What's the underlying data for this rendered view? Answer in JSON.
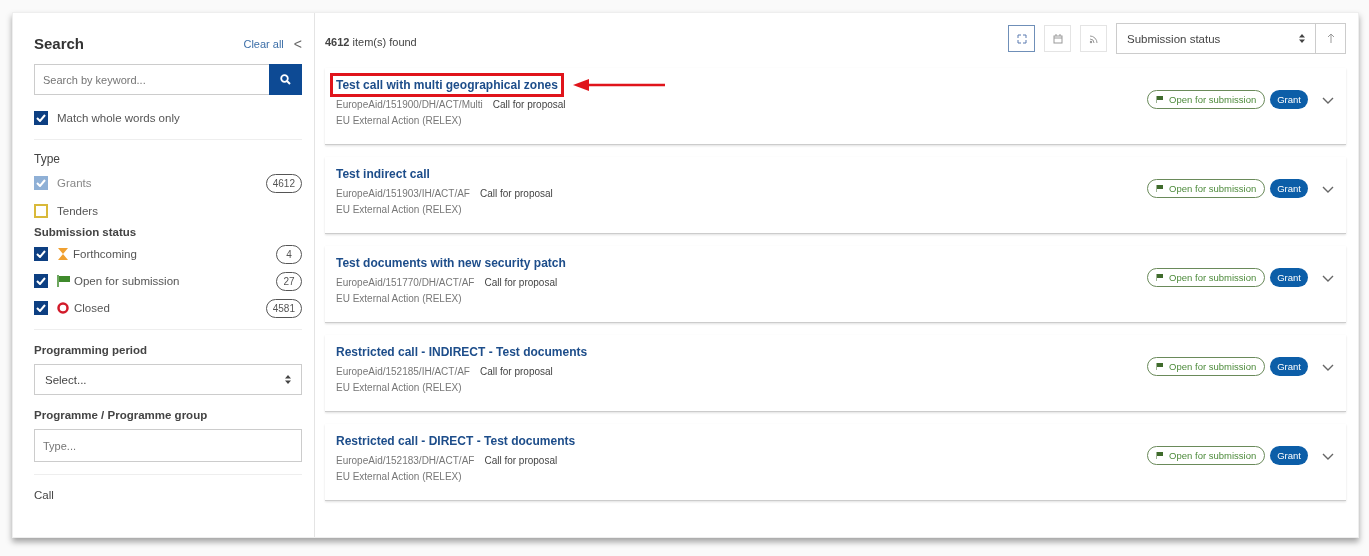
{
  "sidebar": {
    "title": "Search",
    "clear_all": "Clear all",
    "collapse": "<",
    "search": {
      "placeholder": "Search by keyword..."
    },
    "match_whole_words": {
      "label": "Match whole words only",
      "checked": true
    },
    "type": {
      "title": "Type",
      "items": [
        {
          "label": "Grants",
          "count": "4612",
          "checked": true,
          "disabled": true
        },
        {
          "label": "Tenders",
          "checked": false,
          "disabled": false
        }
      ]
    },
    "submission_status": {
      "title": "Submission status",
      "items": [
        {
          "kind": "forthcoming",
          "label": "Forthcoming",
          "count": "4",
          "checked": true
        },
        {
          "kind": "open",
          "label": "Open for submission",
          "count": "27",
          "checked": true
        },
        {
          "kind": "closed",
          "label": "Closed",
          "count": "4581",
          "checked": true
        }
      ]
    },
    "programming_period": {
      "label": "Programming period",
      "value": "Select..."
    },
    "programme": {
      "label": "Programme / Programme group",
      "placeholder": "Type..."
    },
    "call": {
      "label": "Call"
    }
  },
  "results": {
    "count": "4612",
    "count_label": "item(s) found",
    "views": [
      {
        "kind": "grid",
        "selected": true
      },
      {
        "kind": "calendar",
        "selected": false
      },
      {
        "kind": "rss",
        "selected": false
      }
    ],
    "sort": {
      "value": "Submission status"
    },
    "items": [
      {
        "title": "Test call with multi geographical zones",
        "reference": "EuropeAid/151900/DH/ACT/Multi",
        "type": "Call for proposal",
        "programme": "EU External Action (RELEX)",
        "status": "Open for submission",
        "badge": "Grant",
        "highlighted": true
      },
      {
        "title": "Test indirect call",
        "reference": "EuropeAid/151903/IH/ACT/AF",
        "type": "Call for proposal",
        "programme": "EU External Action (RELEX)",
        "status": "Open for submission",
        "badge": "Grant",
        "highlighted": false
      },
      {
        "title": "Test documents with new security patch",
        "reference": "EuropeAid/151770/DH/ACT/AF",
        "type": "Call for proposal",
        "programme": "EU External Action (RELEX)",
        "status": "Open for submission",
        "badge": "Grant",
        "highlighted": false
      },
      {
        "title": "Restricted call - INDIRECT - Test documents",
        "reference": "EuropeAid/152185/IH/ACT/AF",
        "type": "Call for proposal",
        "programme": "EU External Action (RELEX)",
        "status": "Open for submission",
        "badge": "Grant",
        "highlighted": false
      },
      {
        "title": "Restricted call - DIRECT - Test documents",
        "reference": "EuropeAid/152183/DH/ACT/AF",
        "type": "Call for proposal",
        "programme": "EU External Action (RELEX)",
        "status": "Open for submission",
        "badge": "Grant",
        "highlighted": false
      }
    ]
  }
}
